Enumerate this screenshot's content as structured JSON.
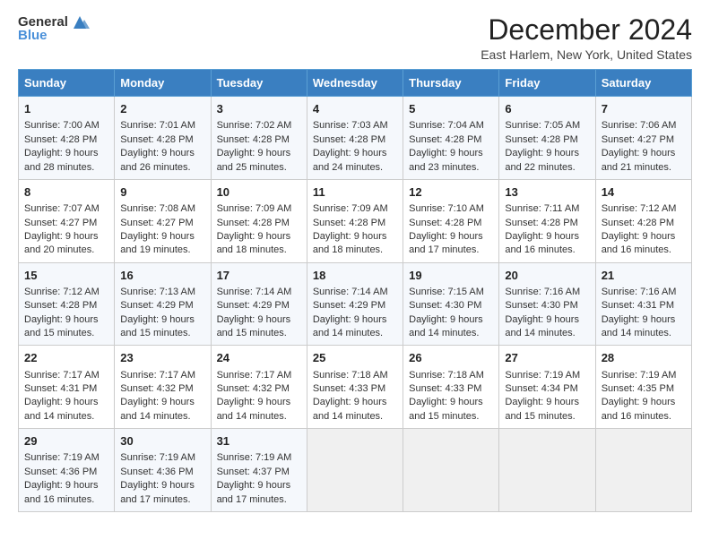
{
  "header": {
    "logo_general": "General",
    "logo_blue": "Blue",
    "title": "December 2024",
    "subtitle": "East Harlem, New York, United States"
  },
  "columns": [
    "Sunday",
    "Monday",
    "Tuesday",
    "Wednesday",
    "Thursday",
    "Friday",
    "Saturday"
  ],
  "weeks": [
    [
      {
        "day": "1",
        "sunrise": "Sunrise: 7:00 AM",
        "sunset": "Sunset: 4:28 PM",
        "daylight": "Daylight: 9 hours and 28 minutes."
      },
      {
        "day": "2",
        "sunrise": "Sunrise: 7:01 AM",
        "sunset": "Sunset: 4:28 PM",
        "daylight": "Daylight: 9 hours and 26 minutes."
      },
      {
        "day": "3",
        "sunrise": "Sunrise: 7:02 AM",
        "sunset": "Sunset: 4:28 PM",
        "daylight": "Daylight: 9 hours and 25 minutes."
      },
      {
        "day": "4",
        "sunrise": "Sunrise: 7:03 AM",
        "sunset": "Sunset: 4:28 PM",
        "daylight": "Daylight: 9 hours and 24 minutes."
      },
      {
        "day": "5",
        "sunrise": "Sunrise: 7:04 AM",
        "sunset": "Sunset: 4:28 PM",
        "daylight": "Daylight: 9 hours and 23 minutes."
      },
      {
        "day": "6",
        "sunrise": "Sunrise: 7:05 AM",
        "sunset": "Sunset: 4:28 PM",
        "daylight": "Daylight: 9 hours and 22 minutes."
      },
      {
        "day": "7",
        "sunrise": "Sunrise: 7:06 AM",
        "sunset": "Sunset: 4:27 PM",
        "daylight": "Daylight: 9 hours and 21 minutes."
      }
    ],
    [
      {
        "day": "8",
        "sunrise": "Sunrise: 7:07 AM",
        "sunset": "Sunset: 4:27 PM",
        "daylight": "Daylight: 9 hours and 20 minutes."
      },
      {
        "day": "9",
        "sunrise": "Sunrise: 7:08 AM",
        "sunset": "Sunset: 4:27 PM",
        "daylight": "Daylight: 9 hours and 19 minutes."
      },
      {
        "day": "10",
        "sunrise": "Sunrise: 7:09 AM",
        "sunset": "Sunset: 4:28 PM",
        "daylight": "Daylight: 9 hours and 18 minutes."
      },
      {
        "day": "11",
        "sunrise": "Sunrise: 7:09 AM",
        "sunset": "Sunset: 4:28 PM",
        "daylight": "Daylight: 9 hours and 18 minutes."
      },
      {
        "day": "12",
        "sunrise": "Sunrise: 7:10 AM",
        "sunset": "Sunset: 4:28 PM",
        "daylight": "Daylight: 9 hours and 17 minutes."
      },
      {
        "day": "13",
        "sunrise": "Sunrise: 7:11 AM",
        "sunset": "Sunset: 4:28 PM",
        "daylight": "Daylight: 9 hours and 16 minutes."
      },
      {
        "day": "14",
        "sunrise": "Sunrise: 7:12 AM",
        "sunset": "Sunset: 4:28 PM",
        "daylight": "Daylight: 9 hours and 16 minutes."
      }
    ],
    [
      {
        "day": "15",
        "sunrise": "Sunrise: 7:12 AM",
        "sunset": "Sunset: 4:28 PM",
        "daylight": "Daylight: 9 hours and 15 minutes."
      },
      {
        "day": "16",
        "sunrise": "Sunrise: 7:13 AM",
        "sunset": "Sunset: 4:29 PM",
        "daylight": "Daylight: 9 hours and 15 minutes."
      },
      {
        "day": "17",
        "sunrise": "Sunrise: 7:14 AM",
        "sunset": "Sunset: 4:29 PM",
        "daylight": "Daylight: 9 hours and 15 minutes."
      },
      {
        "day": "18",
        "sunrise": "Sunrise: 7:14 AM",
        "sunset": "Sunset: 4:29 PM",
        "daylight": "Daylight: 9 hours and 14 minutes."
      },
      {
        "day": "19",
        "sunrise": "Sunrise: 7:15 AM",
        "sunset": "Sunset: 4:30 PM",
        "daylight": "Daylight: 9 hours and 14 minutes."
      },
      {
        "day": "20",
        "sunrise": "Sunrise: 7:16 AM",
        "sunset": "Sunset: 4:30 PM",
        "daylight": "Daylight: 9 hours and 14 minutes."
      },
      {
        "day": "21",
        "sunrise": "Sunrise: 7:16 AM",
        "sunset": "Sunset: 4:31 PM",
        "daylight": "Daylight: 9 hours and 14 minutes."
      }
    ],
    [
      {
        "day": "22",
        "sunrise": "Sunrise: 7:17 AM",
        "sunset": "Sunset: 4:31 PM",
        "daylight": "Daylight: 9 hours and 14 minutes."
      },
      {
        "day": "23",
        "sunrise": "Sunrise: 7:17 AM",
        "sunset": "Sunset: 4:32 PM",
        "daylight": "Daylight: 9 hours and 14 minutes."
      },
      {
        "day": "24",
        "sunrise": "Sunrise: 7:17 AM",
        "sunset": "Sunset: 4:32 PM",
        "daylight": "Daylight: 9 hours and 14 minutes."
      },
      {
        "day": "25",
        "sunrise": "Sunrise: 7:18 AM",
        "sunset": "Sunset: 4:33 PM",
        "daylight": "Daylight: 9 hours and 14 minutes."
      },
      {
        "day": "26",
        "sunrise": "Sunrise: 7:18 AM",
        "sunset": "Sunset: 4:33 PM",
        "daylight": "Daylight: 9 hours and 15 minutes."
      },
      {
        "day": "27",
        "sunrise": "Sunrise: 7:19 AM",
        "sunset": "Sunset: 4:34 PM",
        "daylight": "Daylight: 9 hours and 15 minutes."
      },
      {
        "day": "28",
        "sunrise": "Sunrise: 7:19 AM",
        "sunset": "Sunset: 4:35 PM",
        "daylight": "Daylight: 9 hours and 16 minutes."
      }
    ],
    [
      {
        "day": "29",
        "sunrise": "Sunrise: 7:19 AM",
        "sunset": "Sunset: 4:36 PM",
        "daylight": "Daylight: 9 hours and 16 minutes."
      },
      {
        "day": "30",
        "sunrise": "Sunrise: 7:19 AM",
        "sunset": "Sunset: 4:36 PM",
        "daylight": "Daylight: 9 hours and 17 minutes."
      },
      {
        "day": "31",
        "sunrise": "Sunrise: 7:19 AM",
        "sunset": "Sunset: 4:37 PM",
        "daylight": "Daylight: 9 hours and 17 minutes."
      },
      {
        "day": "",
        "sunrise": "",
        "sunset": "",
        "daylight": ""
      },
      {
        "day": "",
        "sunrise": "",
        "sunset": "",
        "daylight": ""
      },
      {
        "day": "",
        "sunrise": "",
        "sunset": "",
        "daylight": ""
      },
      {
        "day": "",
        "sunrise": "",
        "sunset": "",
        "daylight": ""
      }
    ]
  ]
}
